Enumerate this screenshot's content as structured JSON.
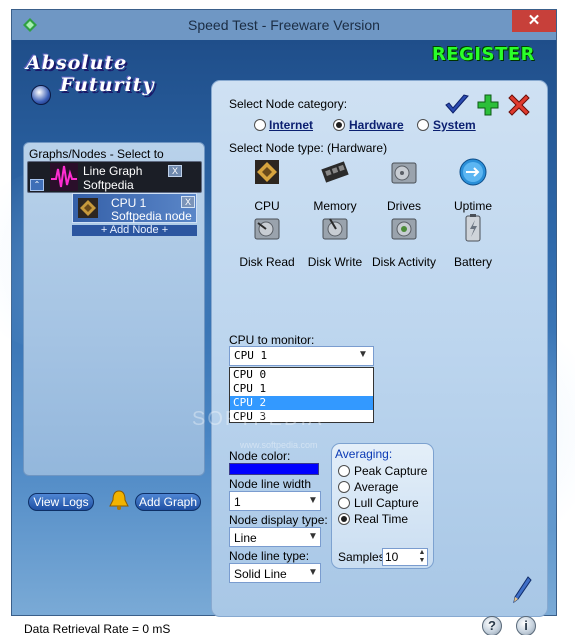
{
  "window": {
    "title": "Speed Test - Freeware Version",
    "close_glyph": "✕"
  },
  "brand": {
    "logo_line1": "Absolute",
    "logo_line2": "Futurity",
    "register": "REGISTER"
  },
  "left": {
    "graphs_label": "Graphs/Nodes - Select to modify:",
    "graph": {
      "name": "Line Graph",
      "sub": "Softpedia",
      "expand_glyph": "⌃",
      "close_glyph": "X"
    },
    "node": {
      "name": "CPU 1",
      "sub": "Softpedia node",
      "close_glyph": "X"
    },
    "add_node": "+ Add Node +",
    "view_logs": "View Logs",
    "add_graph": "Add Graph"
  },
  "status": "Data Retrieval Rate = 0 mS",
  "right": {
    "node_category_label": "Select Node category:",
    "categories": [
      {
        "label": "Internet",
        "selected": false
      },
      {
        "label": "Hardware",
        "selected": true
      },
      {
        "label": "System",
        "selected": false
      }
    ],
    "node_type_label": "Select Node type:  (Hardware)",
    "node_types": [
      "CPU",
      "Memory",
      "Drives",
      "Uptime",
      "Disk Read",
      "Disk Write",
      "Disk Activity",
      "Battery"
    ],
    "cpu_label": "CPU to monitor:",
    "cpu_selected": "CPU 1",
    "cpu_options": [
      "CPU 0",
      "CPU 1",
      "CPU 2",
      "CPU 3"
    ],
    "cpu_highlighted": "CPU 2",
    "node_color_label": "Node color:",
    "node_color": "#0000ff",
    "line_width_label": "Node line width",
    "line_width": "1",
    "display_type_label": "Node display type:",
    "display_type": "Line",
    "line_type_label": "Node line type:",
    "line_type": "Solid Line",
    "averaging": {
      "label": "Averaging:",
      "options": [
        {
          "label": "Peak Capture",
          "selected": false
        },
        {
          "label": "Average",
          "selected": false
        },
        {
          "label": "Lull Capture",
          "selected": false
        },
        {
          "label": "Real Time",
          "selected": true
        }
      ],
      "samples_label": "Samples:",
      "samples": "10"
    }
  },
  "footer": {
    "help_glyph": "?",
    "info_glyph": "i"
  },
  "watermark": {
    "main": "SOFTPEDIA",
    "sub": "www.softpedia.com"
  },
  "colors": {
    "accent_blue": "#2f69aa",
    "register_green": "#2aff2a",
    "selection": "#3399ff"
  }
}
